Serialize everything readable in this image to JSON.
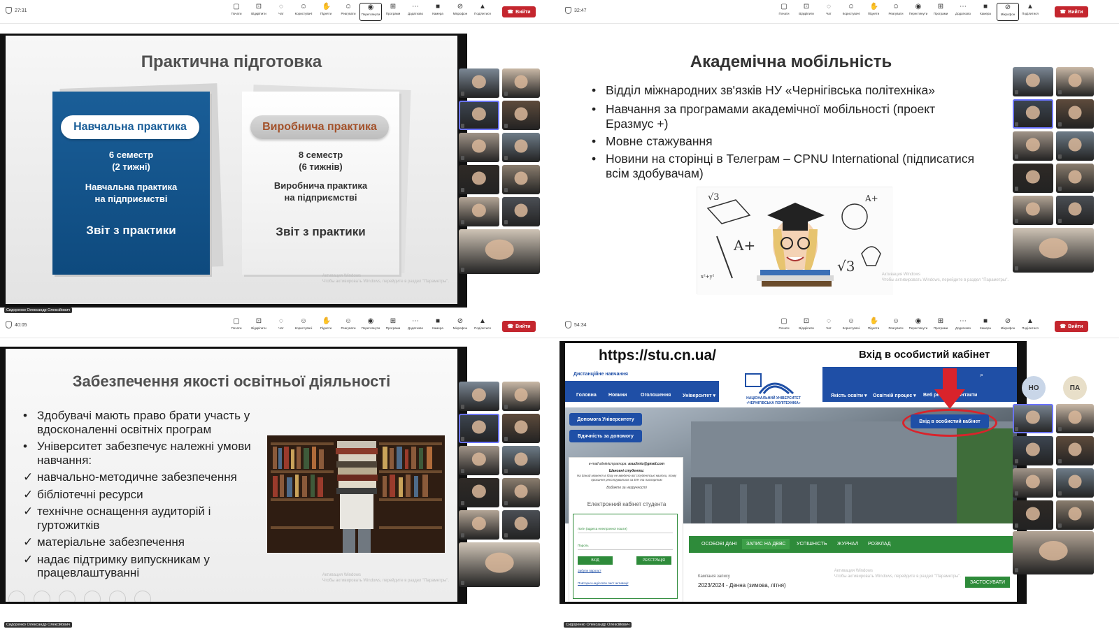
{
  "toolbar": {
    "tools": [
      {
        "label": "Почати",
        "icon": "share-screen-icon"
      },
      {
        "label": "Відкріпити",
        "icon": "unpin-icon"
      },
      {
        "label": "Чат",
        "icon": "chat-icon"
      },
      {
        "label": "Користувачі",
        "icon": "people-icon"
      },
      {
        "label": "Підняти",
        "icon": "raise-hand-icon"
      },
      {
        "label": "Реагувати",
        "icon": "react-icon"
      },
      {
        "label": "Переглянути",
        "icon": "view-icon"
      },
      {
        "label": "Програми",
        "icon": "apps-icon"
      },
      {
        "label": "Додатково",
        "icon": "more-icon"
      },
      {
        "label": "Камера",
        "icon": "camera-icon"
      },
      {
        "label": "Мікрофон",
        "icon": "mic-off-icon"
      },
      {
        "label": "Поділитися",
        "icon": "share-icon"
      }
    ],
    "people_count": "11",
    "leave_label": "Вийти"
  },
  "q1": {
    "timer": "27:31",
    "presenter": "Сидоренко Олександр Олексійович",
    "title": "Практична підготовка",
    "card_left": {
      "pill": "Навчальна практика",
      "line1": "6 семестр",
      "line2": "(2 тижні)",
      "line3": "Навчальна практика",
      "line4": "на підприємстві",
      "line5": "Звіт з практики"
    },
    "card_right": {
      "pill": "Виробнича практика",
      "line1": "8 семестр",
      "line2": "(6 тижнів)",
      "line3": "Виробнича практика",
      "line4": "на підприємстві",
      "line5": "Звіт з практики"
    },
    "watermark1": "Активация Windows",
    "watermark2": "Чтобы активировать Windows, перейдите в раздел \"Параметры\"."
  },
  "q2": {
    "timer": "32:47",
    "title": "Академічна мобільність",
    "bullets": [
      "Відділ міжнародних зв'язків НУ «Чернігівська політехніка»",
      "Навчання за програмами академічної мобільності (проект Еразмус +)",
      "Мовне стажування",
      "Новини на сторінці в Телеграм – CPNU International (підписатися всім здобувачам)"
    ],
    "watermark1": "Активация Windows",
    "watermark2": "Чтобы активировать Windows, перейдите в раздел \"Параметры\"."
  },
  "q3": {
    "timer": "40:05",
    "presenter": "Сидоренко Олександр Олексійович",
    "title": "Забезпечення якості освітньої діяльності",
    "items": [
      {
        "mark": "•",
        "text": "Здобувачі мають право брати участь у вдосконаленні освітніх програм"
      },
      {
        "mark": "•",
        "text": "Університет забезпечує належні умови навчання:"
      },
      {
        "mark": "✓",
        "text": "навчально-методичне забезпечення"
      },
      {
        "mark": "✓",
        "text": "бібліотечні ресурси"
      },
      {
        "mark": "✓",
        "text": "технічне оснащення аудиторій і гуртожитків"
      },
      {
        "mark": "✓",
        "text": "матеріальне забезпечення"
      },
      {
        "mark": "✓",
        "text": "надає підтримку випускникам у працевлаштуванні"
      }
    ],
    "watermark1": "Активация Windows",
    "watermark2": "Чтобы активировать Windows, перейдите в раздел \"Параметры\"."
  },
  "q4": {
    "timer": "54:34",
    "presenter": "Сидоренко Олександр Олексійович",
    "url": "https://stu.cn.ua/",
    "heading": "Вхід в особистий кабінет",
    "distance": "Дистанційне навчання",
    "nav_left": [
      "Головна",
      "Новини",
      "Оголошення",
      "Університет ▾"
    ],
    "nav_right": [
      "Якість освіти ▾",
      "Освітній процес ▾",
      "Веб ресурси",
      "Контакти"
    ],
    "logo_line1": "НАЦІОНАЛЬНИЙ УНІВЕРСИТЕТ",
    "logo_line2": "«ЧЕРНІГІВСЬКА ПОЛІТЕХНІКА»",
    "help_btn": "Допомога Університету",
    "thanks_btn": "Вдячність за допомогу",
    "cabinet_btn": "Вхід в особистий кабінет",
    "admin_email_label": "e-mail адміністратора:",
    "admin_email": "asuchntu@gmail.com",
    "students_title": "Шановні студенти:",
    "students_note": "На даний момент в базу не введено всі студентські квитки, тому прохання реєструватися за ЕІН та паспортом",
    "apology": "Вибачте за незручності",
    "cabinet_title": "Електронний кабінет студента",
    "login_placeholder": "Логін (адреса електронної пошти)",
    "password_label": "Пароль",
    "login_btn": "ВХІД",
    "register_btn": "РЕЄСТРАЦІЯ",
    "forgot": "Забули пароль?",
    "resend": "Повторно надіслати лист активації",
    "tabs": [
      "ОСОБОВІ ДАНІ",
      "ЗАПИС НА ДВВС",
      "УСПІШНІСТЬ",
      "ЖУРНАЛ",
      "РОЗКЛАД"
    ],
    "campaign_label": "Кампанія запису",
    "campaign_value": "2023/2024 - Денна (зимова, літня)",
    "apply_btn": "ЗАСТОСУВАТИ",
    "avatars": [
      "НО",
      "ПА"
    ],
    "watermark1": "Активация Windows",
    "watermark2": "Чтобы активировать Windows, перейдите в раздел \"Параметры\"."
  },
  "colors": {
    "leave": "#c4262e",
    "blue": "#1f4fa6",
    "green": "#2e8b3a",
    "card_blue": "#1a5e98"
  }
}
